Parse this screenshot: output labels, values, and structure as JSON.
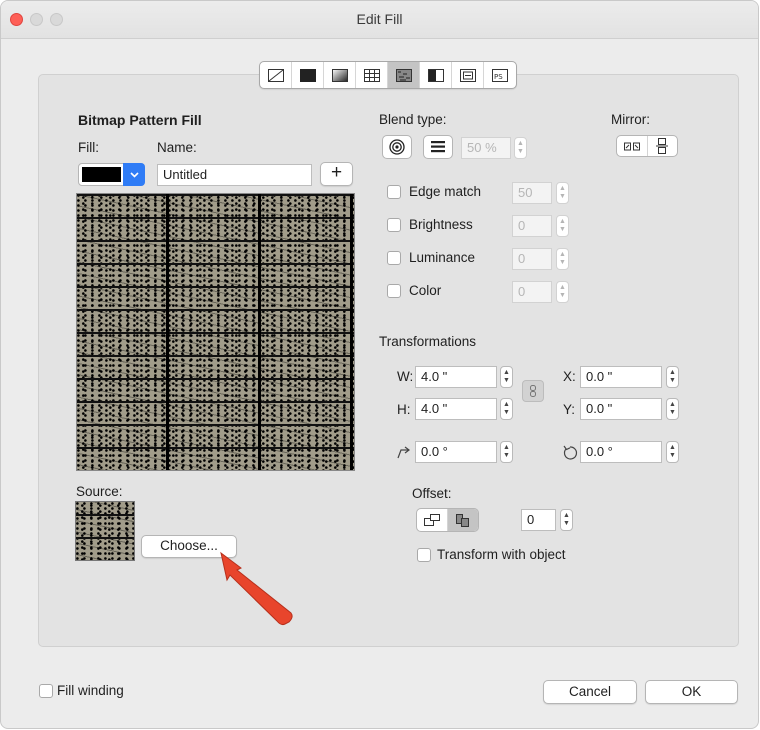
{
  "window": {
    "title": "Edit Fill"
  },
  "toolbar": {
    "icons": [
      "no-fill-icon",
      "uniform-fill-icon",
      "fountain-fill-icon",
      "vector-pattern-icon",
      "bitmap-pattern-icon",
      "two-color-pattern-icon",
      "texture-fill-icon",
      "postscript-fill-icon"
    ],
    "active": "bitmap-pattern-icon"
  },
  "left": {
    "heading": "Bitmap Pattern Fill",
    "fill_label": "Fill:",
    "name_label": "Name:",
    "name_value": "Untitled",
    "fill_color": "#000000",
    "add_button": "+",
    "source_label": "Source:",
    "choose_button": "Choose..."
  },
  "blend": {
    "label": "Blend type:",
    "percent": "50 %",
    "mirror_label": "Mirror:"
  },
  "options": [
    {
      "label": "Edge match",
      "value": "50"
    },
    {
      "label": "Brightness",
      "value": "0"
    },
    {
      "label": "Luminance",
      "value": "0"
    },
    {
      "label": "Color",
      "value": "0"
    }
  ],
  "transform": {
    "heading": "Transformations",
    "w_label": "W:",
    "w_value": "4.0 \"",
    "h_label": "H:",
    "h_value": "4.0 \"",
    "x_label": "X:",
    "x_value": "0.0 \"",
    "y_label": "Y:",
    "y_value": "0.0 \"",
    "skew_value": "0.0 °",
    "rotate_value": "0.0 °"
  },
  "offset": {
    "label": "Offset:",
    "value": "0",
    "transform_with_object": "Transform with object"
  },
  "footer": {
    "fill_winding": "Fill winding",
    "cancel": "Cancel",
    "ok": "OK"
  },
  "colors": {
    "accent": "#2f7cf6",
    "annotation_arrow": "#e8452c"
  }
}
